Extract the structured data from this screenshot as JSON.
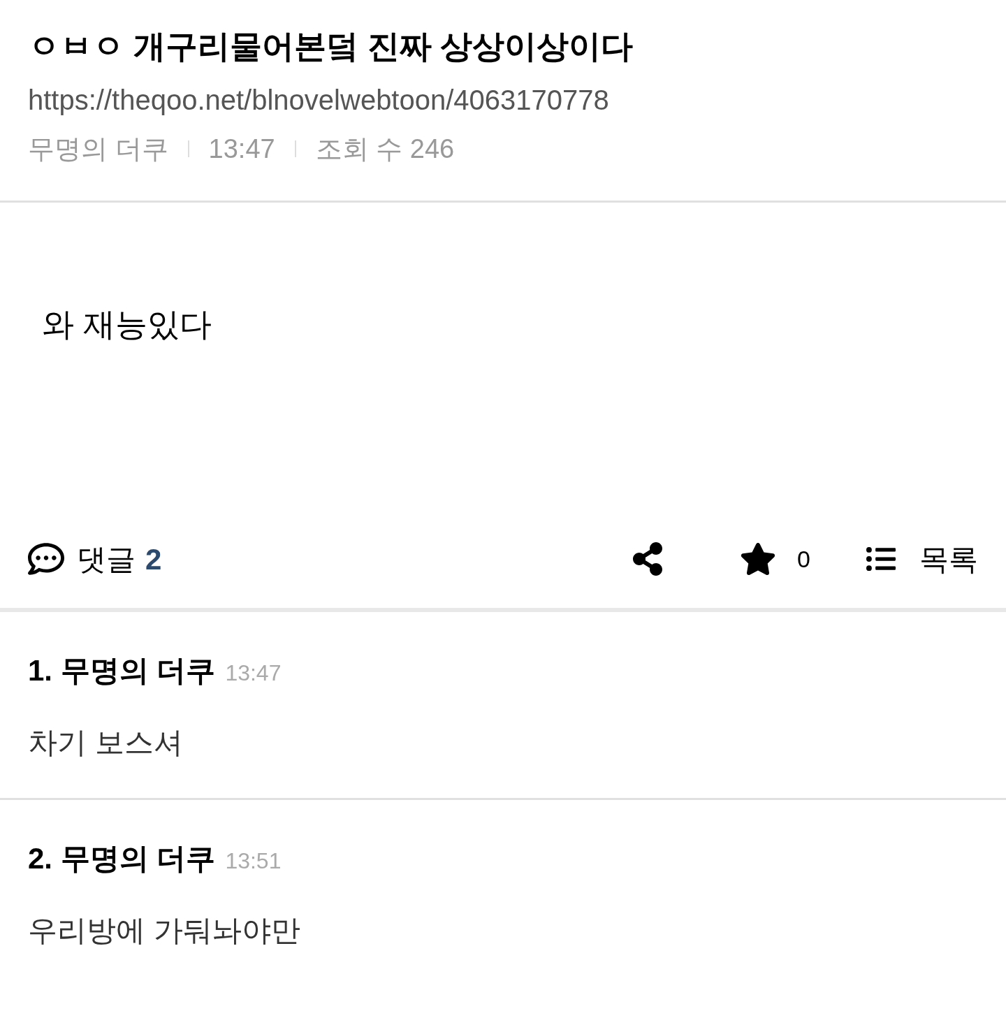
{
  "post": {
    "title": "ㅇㅂㅇ 개구리물어본덬 진짜 상상이상이다",
    "url": "https://theqoo.net/blnovelwebtoon/4063170778",
    "author": "무명의 더쿠",
    "time": "13:47",
    "views": "조회 수 246"
  },
  "body": "와 재능있다",
  "actions": {
    "comments_label": "댓글",
    "comments_count": "2",
    "star_count": "0",
    "list_label": "목록"
  },
  "comments": [
    {
      "number": "1.",
      "author": "무명의 더쿠",
      "time": "13:47",
      "text": "차기 보스셔"
    },
    {
      "number": "2.",
      "author": "무명의 더쿠",
      "time": "13:51",
      "text": "우리방에 가둬놔야만"
    }
  ]
}
